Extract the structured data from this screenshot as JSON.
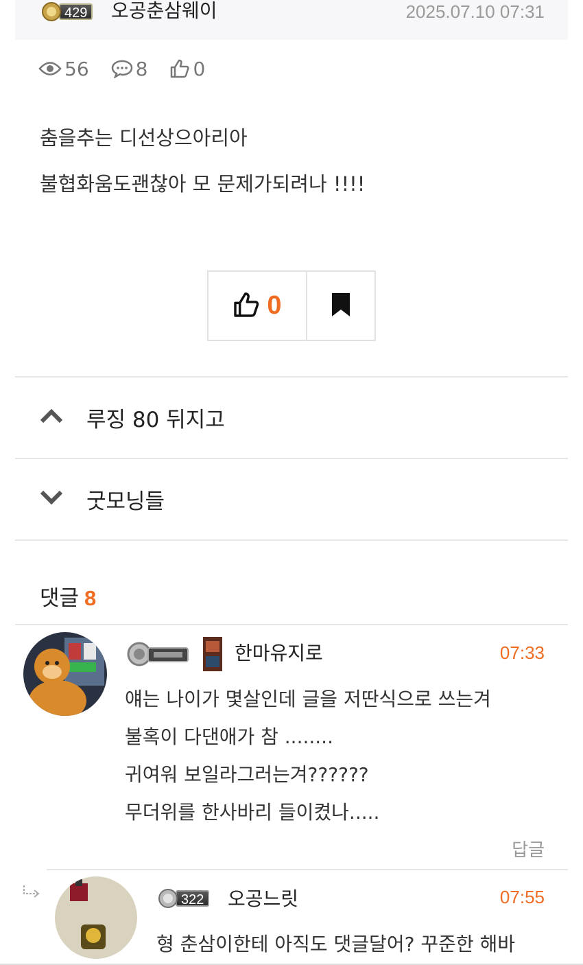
{
  "post": {
    "author_level": "429",
    "author": "오공춘삼웨이",
    "date": "2025.07.10 07:31",
    "views": "56",
    "comments": "8",
    "likes": "0",
    "lines": [
      "춤을추는 디선상으아리아",
      "불협화움도괜찮아 모 문제가되려나 !!!!"
    ]
  },
  "vote": {
    "like_count": "0"
  },
  "nav": {
    "prev_title": "루징 80 뒤지고",
    "next_title": "굿모닝들"
  },
  "comments_section": {
    "label": "댓글",
    "count": "8"
  },
  "comments": [
    {
      "author": "한마유지로",
      "time": "07:33",
      "lines": [
        "얘는 나이가 몇살인데 글을 저딴식으로 쓰는겨",
        "불혹이 다댄애가 참 ........",
        "귀여워 보일라그러는겨??????",
        "무더위를 한사바리 들이켰나....."
      ],
      "reply_label": "답글"
    },
    {
      "author_level": "322",
      "author": "오공느릿",
      "time": "07:55",
      "lines": [
        "형 춘삼이한테 아직도 댓글달어? 꾸준한 해바"
      ]
    }
  ],
  "colors": {
    "accent": "#ef6c22",
    "muted": "#999999",
    "divider": "#e6e6e6"
  }
}
